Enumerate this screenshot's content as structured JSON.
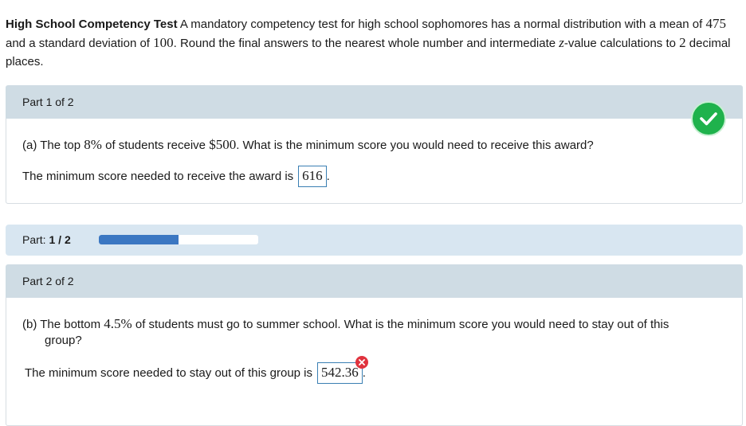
{
  "intro": {
    "title": "High School Competency Test",
    "t1": " A mandatory competency test for high school sophomores has a normal distribution with a mean of ",
    "mean": "475",
    "t2": " and a standard deviation of ",
    "sd": "100",
    "t3": ". Round the final answers to the nearest whole number and intermediate ",
    "z": "z",
    "t4": "-value calculations to ",
    "places": "2",
    "t5": " decimal places."
  },
  "part1": {
    "header": "Part 1 of 2",
    "q_prefix": "(a) The top ",
    "q_pct": "8%",
    "q_mid": " of students receive ",
    "q_amount": "$500",
    "q_suffix": ". What is the minimum score you would need to receive this award?",
    "answer_label": "The minimum score needed to receive the award is",
    "answer_value": "616",
    "answer_end": ".",
    "status_icon": "check-circle-icon",
    "status_color": "#1fb24c"
  },
  "progress": {
    "label": "Part:",
    "current": "1",
    "sep": " / ",
    "total": "2",
    "fraction": 0.5,
    "color": "#3b77c2"
  },
  "part2": {
    "header": "Part 2 of 2",
    "q_prefix": "(b) The bottom ",
    "q_pct": "4.5%",
    "q_suffix": " of students must go to summer school. What is the minimum score you would need to stay out of this",
    "q_line2": "group?",
    "answer_label": "The minimum score needed to stay out of this group is",
    "answer_value": "542.36",
    "answer_end": ".",
    "status_icon": "error-x-icon",
    "status_color": "#e0333e"
  }
}
